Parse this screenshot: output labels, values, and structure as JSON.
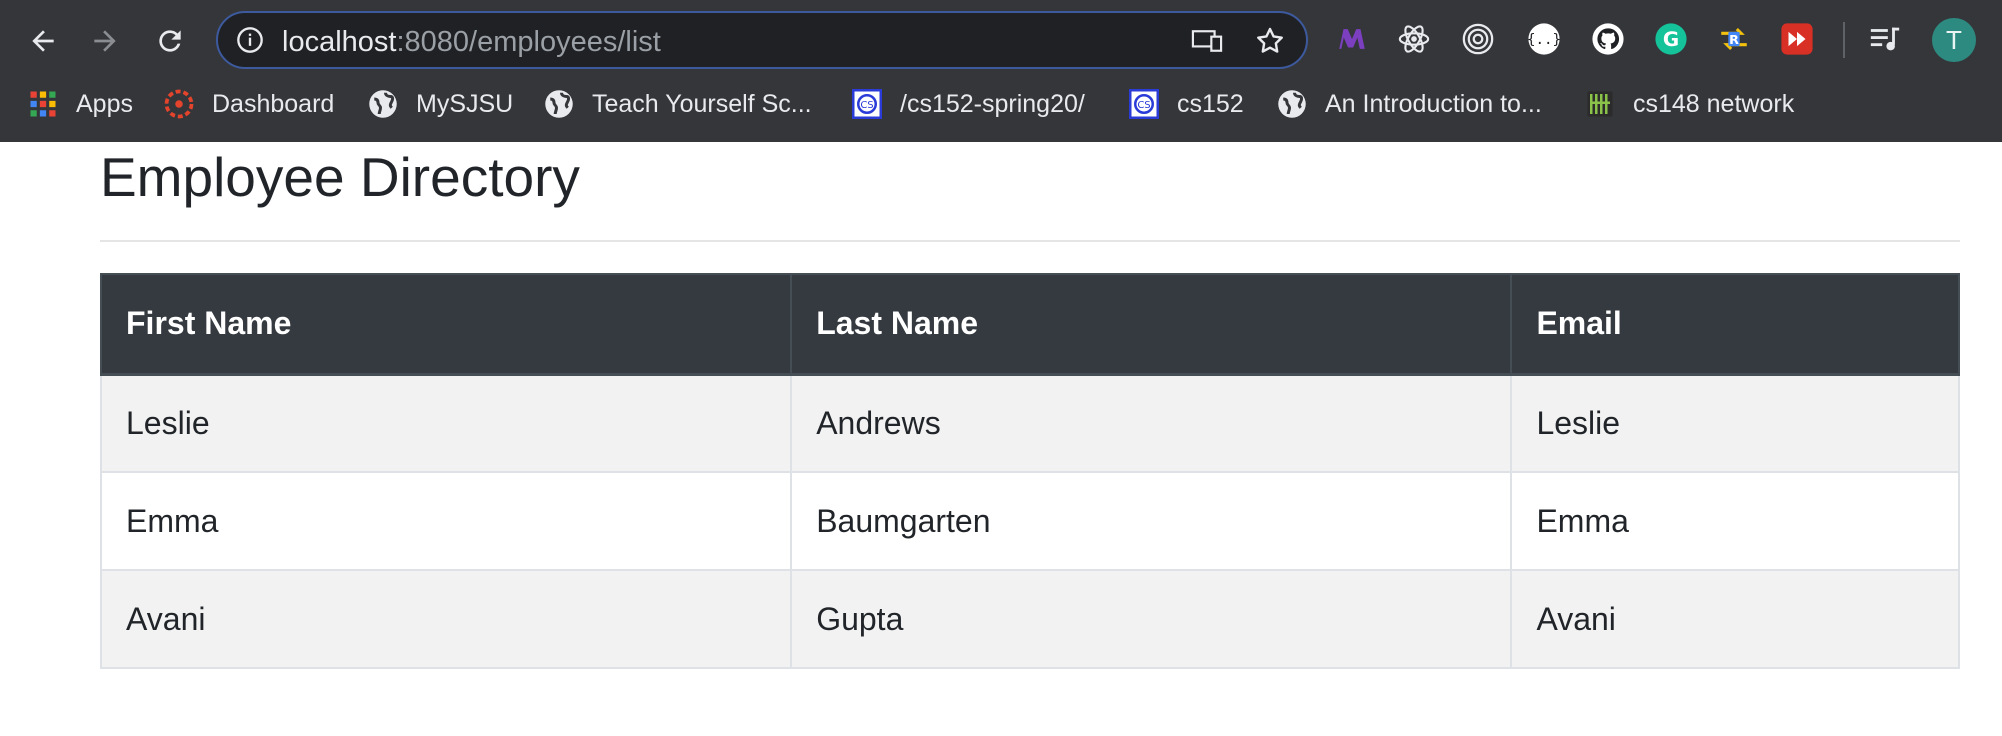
{
  "browser": {
    "url_host": "localhost",
    "url_path": ":8080/employees/list",
    "avatar_letter": "T",
    "icons": {
      "back": "back-arrow-icon",
      "forward": "forward-arrow-icon",
      "reload": "reload-icon",
      "info": "info-icon",
      "cast": "cast-icon",
      "star": "star-icon",
      "media": "media-control-icon"
    },
    "extensions": [
      "m-extension-icon",
      "react-icon",
      "target-icon",
      "json-icon",
      "github-icon",
      "grammarly-icon",
      "r-swap-icon",
      "video-skip-icon"
    ],
    "bookmarks": [
      {
        "label": "Apps",
        "icon": "apps-grid-icon"
      },
      {
        "label": "Dashboard",
        "icon": "canvas-icon"
      },
      {
        "label": "MySJSU",
        "icon": "globe-icon"
      },
      {
        "label": "Teach Yourself Sc...",
        "icon": "globe-icon"
      },
      {
        "label": "/cs152-spring20/",
        "icon": "cs-icon"
      },
      {
        "label": "cs152",
        "icon": "cs-icon"
      },
      {
        "label": "An Introduction to...",
        "icon": "globe-icon"
      },
      {
        "label": "cs148 network",
        "icon": "network-icon"
      }
    ],
    "colors": {
      "chrome_bg": "#35363a",
      "omnibox_bg": "#202124",
      "omnibox_focus": "#3d5a9e"
    }
  },
  "page": {
    "title": "Employee Directory",
    "table": {
      "headers": [
        "First Name",
        "Last Name",
        "Email"
      ],
      "rows": [
        [
          "Leslie",
          "Andrews",
          "Leslie"
        ],
        [
          "Emma",
          "Baumgarten",
          "Emma"
        ],
        [
          "Avani",
          "Gupta",
          "Avani"
        ]
      ]
    },
    "colors": {
      "header_bg": "#343a40",
      "stripe_bg": "#f2f2f2"
    }
  }
}
